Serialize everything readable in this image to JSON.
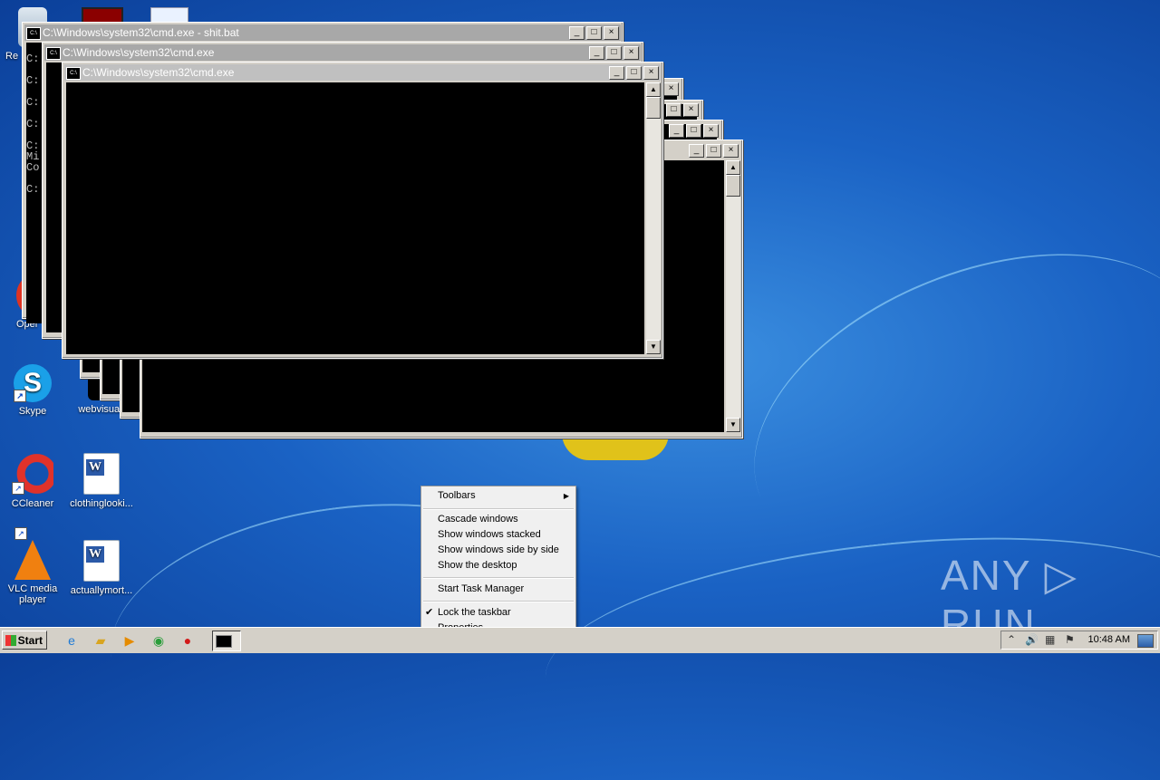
{
  "desktop": {
    "icons": [
      {
        "label": "Re",
        "icon": "recycle-bin-icon"
      },
      {
        "label": "Oper",
        "icon": "opera-icon"
      },
      {
        "label": "Skype",
        "icon": "skype-icon"
      },
      {
        "label": "webvisual.",
        "icon": "file-icon"
      },
      {
        "label": "CCleaner",
        "icon": "ccleaner-icon"
      },
      {
        "label": "clothinglooki...",
        "icon": "word-document-icon"
      },
      {
        "label": "VLC media player",
        "icon": "vlc-icon"
      },
      {
        "label": "actuallymort...",
        "icon": "word-document-icon"
      }
    ]
  },
  "windows": {
    "win1": {
      "title": "C:\\Windows\\system32\\cmd.exe - shit.bat",
      "lines": [
        "C:",
        "C:",
        "C:",
        "C:",
        "C:",
        "Mi",
        "Co",
        "C:"
      ]
    },
    "win2": {
      "title": "C:\\Windows\\system32\\cmd.exe"
    },
    "win3": {
      "title": "C:\\Windows\\system32\\cmd.exe"
    }
  },
  "window_buttons": {
    "minimize": "_",
    "maximize": "□",
    "close": "×"
  },
  "context_menu": {
    "items": [
      {
        "label": "Toolbars",
        "has_submenu": true
      },
      {
        "label": "Cascade windows"
      },
      {
        "label": "Show windows stacked"
      },
      {
        "label": "Show windows side by side"
      },
      {
        "label": "Show the desktop"
      },
      {
        "label": "Start Task Manager"
      },
      {
        "label": "Lock the taskbar",
        "checked": true
      },
      {
        "label": "Properties"
      }
    ],
    "submenu_arrow": "▶",
    "check_mark": "✔"
  },
  "taskbar": {
    "start_label": "Start",
    "quick_launch": [
      "internet-explorer-icon",
      "explorer-folder-icon",
      "media-player-icon",
      "chrome-icon",
      "opera-icon"
    ],
    "clock": "10:48 AM"
  },
  "watermark": "ANY ▷ RUN",
  "colors": {
    "desktop_blue": "#1a62c4",
    "console_bg": "#000000",
    "menu_bg": "#f0f0f0",
    "taskbar_bg": "#d4d0c8"
  }
}
